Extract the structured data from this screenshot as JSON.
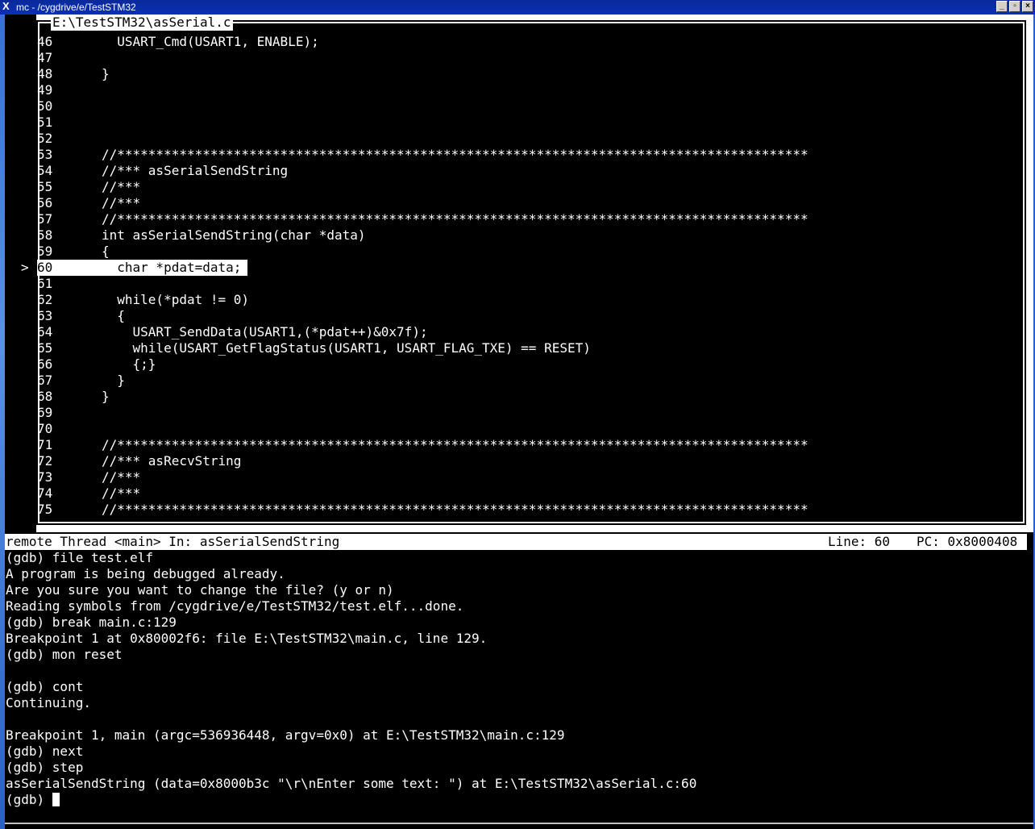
{
  "window": {
    "title": "mc - /cygdrive/e/TestSTM32",
    "icon_glyph": "X",
    "controls": [
      "_",
      "▫",
      "×"
    ]
  },
  "source": {
    "filename": "E:\\TestSTM32\\asSerial.c",
    "current_marker": ">",
    "lines": [
      {
        "num": "46",
        "code": "  USART_Cmd(USART1, ENABLE);"
      },
      {
        "num": "47",
        "code": ""
      },
      {
        "num": "48",
        "code": "}"
      },
      {
        "num": "49",
        "code": ""
      },
      {
        "num": "50",
        "code": ""
      },
      {
        "num": "51",
        "code": ""
      },
      {
        "num": "52",
        "code": ""
      },
      {
        "num": "53",
        "code": "//*****************************************************************************************"
      },
      {
        "num": "54",
        "code": "//*** asSerialSendString"
      },
      {
        "num": "55",
        "code": "//***"
      },
      {
        "num": "56",
        "code": "//***"
      },
      {
        "num": "57",
        "code": "//*****************************************************************************************"
      },
      {
        "num": "58",
        "code": "int asSerialSendString(char *data)"
      },
      {
        "num": "59",
        "code": "{"
      },
      {
        "num": "60",
        "code": "  char *pdat=data;"
      },
      {
        "num": "61",
        "code": ""
      },
      {
        "num": "62",
        "code": "  while(*pdat != 0)"
      },
      {
        "num": "63",
        "code": "  {"
      },
      {
        "num": "64",
        "code": "    USART_SendData(USART1,(*pdat++)&0x7f);"
      },
      {
        "num": "65",
        "code": "    while(USART_GetFlagStatus(USART1, USART_FLAG_TXE) == RESET)"
      },
      {
        "num": "66",
        "code": "    {;}"
      },
      {
        "num": "67",
        "code": "  }"
      },
      {
        "num": "68",
        "code": "}"
      },
      {
        "num": "69",
        "code": ""
      },
      {
        "num": "70",
        "code": ""
      },
      {
        "num": "71",
        "code": "//*****************************************************************************************"
      },
      {
        "num": "72",
        "code": "//*** asRecvString"
      },
      {
        "num": "73",
        "code": "//***"
      },
      {
        "num": "74",
        "code": "//***"
      },
      {
        "num": "75",
        "code": "//*****************************************************************************************"
      }
    ]
  },
  "status": {
    "left": "remote Thread <main> In: asSerialSendString",
    "line": "Line: 60",
    "pc": "PC: 0x8000408"
  },
  "console": {
    "lines": [
      "(gdb) file test.elf",
      "A program is being debugged already.",
      "Are you sure you want to change the file? (y or n)",
      "Reading symbols from /cygdrive/e/TestSTM32/test.elf...done.",
      "(gdb) break main.c:129",
      "Breakpoint 1 at 0x80002f6: file E:\\TestSTM32\\main.c, line 129.",
      "(gdb) mon reset",
      "",
      "(gdb) cont",
      "Continuing.",
      "",
      "Breakpoint 1, main (argc=536936448, argv=0x0) at E:\\TestSTM32\\main.c:129",
      "(gdb) next",
      "(gdb) step",
      "asSerialSendString (data=0x8000b3c \"\\r\\nEnter some text: \") at E:\\TestSTM32\\asSerial.c:60"
    ],
    "prompt": "(gdb) "
  }
}
